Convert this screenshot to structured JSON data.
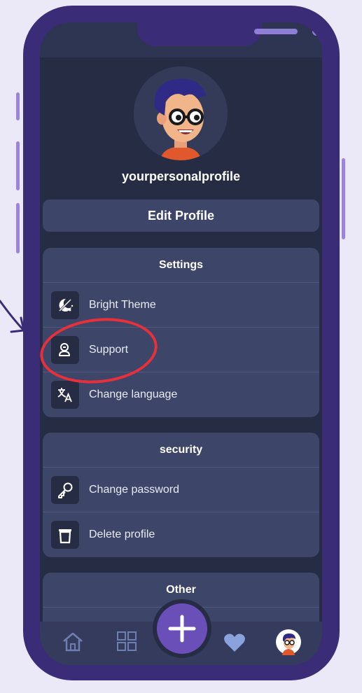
{
  "profile": {
    "username": "yourpersonalprofile",
    "edit_button": "Edit Profile"
  },
  "settings": {
    "title": "Settings",
    "items": [
      {
        "label": "Bright Theme",
        "icon": "bright-theme-icon"
      },
      {
        "label": "Support",
        "icon": "support-icon"
      },
      {
        "label": "Change language",
        "icon": "translate-icon"
      }
    ]
  },
  "security": {
    "title": "security",
    "items": [
      {
        "label": "Change password",
        "icon": "key-icon"
      },
      {
        "label": "Delete profile",
        "icon": "trash-icon"
      }
    ]
  },
  "other": {
    "title": "Other"
  },
  "tabbar": {
    "items": [
      "home-icon",
      "grid-icon",
      "add-icon",
      "heart-icon",
      "avatar-icon"
    ]
  },
  "colors": {
    "frame": "#3b2c78",
    "screen_bg": "#262c44",
    "card_bg": "#3d4568",
    "accent": "#6a4fb8",
    "annotation": "#e8303a"
  }
}
